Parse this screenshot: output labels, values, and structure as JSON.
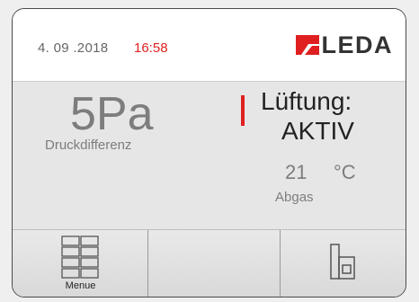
{
  "header": {
    "date": "4. 09 .2018",
    "time": "16:58",
    "brand": "LEDA"
  },
  "pressure": {
    "value": "5Pa",
    "label": "Druckdifferenz"
  },
  "ventilation": {
    "label": "Lüftung:",
    "status": "AKTIV"
  },
  "temperature": {
    "value": "21",
    "unit": "°C",
    "label": "Abgas"
  },
  "footer": {
    "menu_label": "Menue"
  },
  "colors": {
    "accent": "#e02020",
    "text_gray": "#7d7d7d",
    "text_dark": "#222222"
  },
  "icons": {
    "menu": "grid-menu-icon",
    "boiler": "boiler-icon",
    "logo": "leda-flag-icon"
  }
}
